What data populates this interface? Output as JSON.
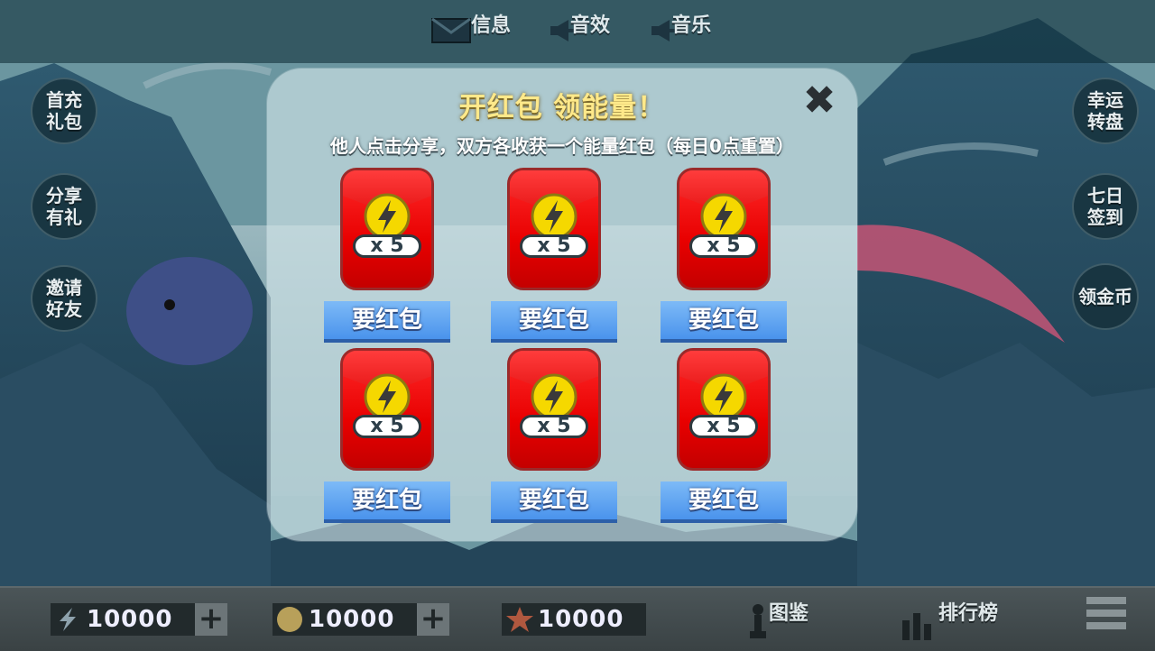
{
  "top": {
    "messages_label": "信息",
    "sound_label": "音效",
    "music_label": "音乐"
  },
  "left_menu": [
    {
      "label": "首充礼包"
    },
    {
      "label": "分享有礼"
    },
    {
      "label": "邀请好友"
    }
  ],
  "right_menu": [
    {
      "label": "幸运转盘"
    },
    {
      "label": "七日签到"
    },
    {
      "label": "领金币"
    }
  ],
  "dialog": {
    "title": "开红包 领能量！",
    "close_symbol": "✖",
    "subtitle": "他人点击分享，双方各收获一个能量红包（每日0点重置）",
    "packets": [
      {
        "quantity": "x 5",
        "button": "要红包"
      },
      {
        "quantity": "x 5",
        "button": "要红包"
      },
      {
        "quantity": "x 5",
        "button": "要红包"
      },
      {
        "quantity": "x 5",
        "button": "要红包"
      },
      {
        "quantity": "x 5",
        "button": "要红包"
      },
      {
        "quantity": "x 5",
        "button": "要红包"
      }
    ]
  },
  "bottom": {
    "energy_value": "10000",
    "coin_value": "10000",
    "star_value": "10000",
    "plus_symbol": "+",
    "collection_label": "图鉴",
    "ranking_label": "排行榜"
  },
  "colors": {
    "packet_red": "#e80000",
    "button_blue": "#4a93ec",
    "title_gold": "#ffe98a",
    "energy_coin": "#f5d800"
  },
  "icons": [
    "mail-icon",
    "speaker-icon",
    "music-icon",
    "lightning-icon",
    "coin-icon",
    "star-icon",
    "chess-piece-icon",
    "bar-chart-icon",
    "menu-icon",
    "close-icon"
  ]
}
